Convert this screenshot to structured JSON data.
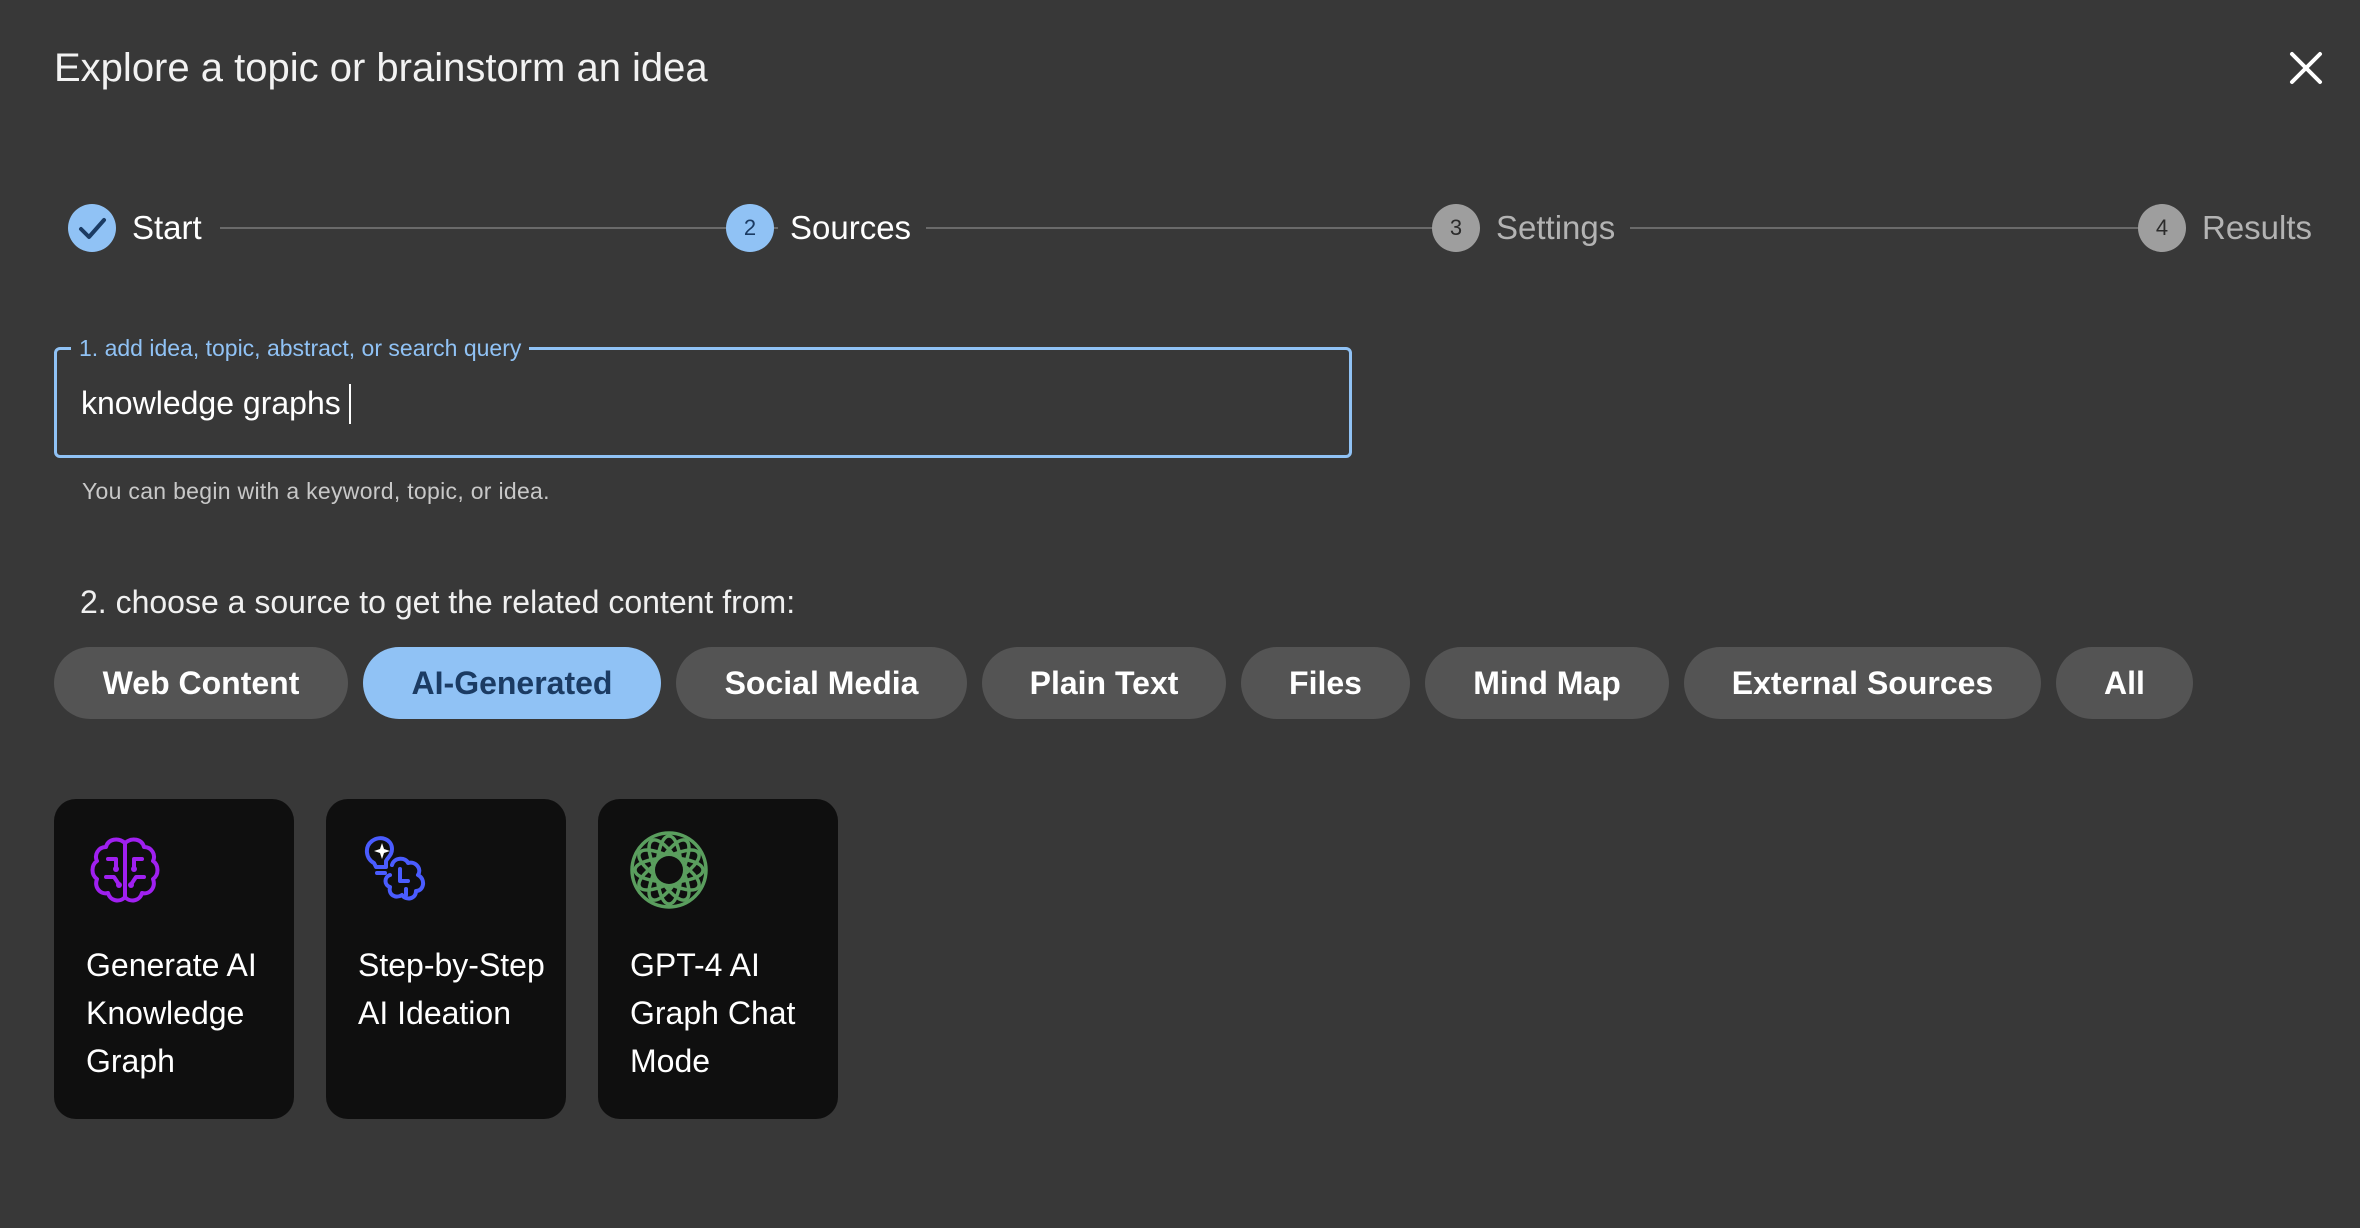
{
  "dialog": {
    "title": "Explore a topic or brainstorm an idea",
    "close_icon": "close-icon"
  },
  "stepper": {
    "steps": [
      {
        "label": "Start",
        "number": "",
        "state": "completed",
        "icon": "check-icon"
      },
      {
        "label": "Sources",
        "number": "2",
        "state": "active"
      },
      {
        "label": "Settings",
        "number": "3",
        "state": "pending"
      },
      {
        "label": "Results",
        "number": "4",
        "state": "pending"
      }
    ]
  },
  "query": {
    "legend": "1. add idea, topic, abstract, or search query",
    "value": "knowledge graphs",
    "helper": "You can begin with a keyword, topic, or idea."
  },
  "sources": {
    "label": "2. choose a source to get the related content from:",
    "chips": [
      {
        "label": "Web Content",
        "selected": false
      },
      {
        "label": "AI-Generated",
        "selected": true
      },
      {
        "label": "Social Media",
        "selected": false
      },
      {
        "label": "Plain Text",
        "selected": false
      },
      {
        "label": "Files",
        "selected": false
      },
      {
        "label": "Mind Map",
        "selected": false
      },
      {
        "label": "External Sources",
        "selected": false
      },
      {
        "label": "All",
        "selected": false
      }
    ]
  },
  "cards": [
    {
      "label": "Generate AI Knowledge Graph",
      "icon": "brain-circuit-icon",
      "color": "#a020f0"
    },
    {
      "label": "Step-by-Step AI Ideation",
      "icon": "lightbulb-brain-icon",
      "color": "#4a5cff"
    },
    {
      "label": "GPT-4 AI Graph Chat Mode",
      "icon": "openai-icon",
      "color": "#5a9e5e"
    }
  ],
  "colors": {
    "background": "#383838",
    "accent": "#90c2f5",
    "chip": "#545454",
    "card": "#0f0f0f"
  }
}
